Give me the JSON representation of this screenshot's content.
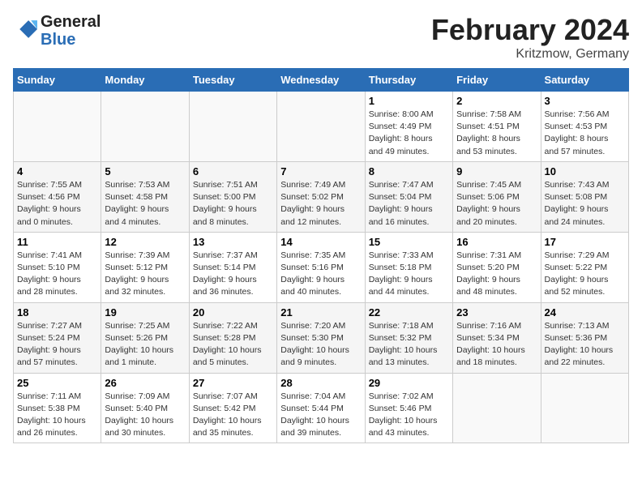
{
  "logo": {
    "line1": "General",
    "line2": "Blue"
  },
  "title": "February 2024",
  "subtitle": "Kritzmow, Germany",
  "weekdays": [
    "Sunday",
    "Monday",
    "Tuesday",
    "Wednesday",
    "Thursday",
    "Friday",
    "Saturday"
  ],
  "weeks": [
    [
      {
        "day": "",
        "info": ""
      },
      {
        "day": "",
        "info": ""
      },
      {
        "day": "",
        "info": ""
      },
      {
        "day": "",
        "info": ""
      },
      {
        "day": "1",
        "info": "Sunrise: 8:00 AM\nSunset: 4:49 PM\nDaylight: 8 hours\nand 49 minutes."
      },
      {
        "day": "2",
        "info": "Sunrise: 7:58 AM\nSunset: 4:51 PM\nDaylight: 8 hours\nand 53 minutes."
      },
      {
        "day": "3",
        "info": "Sunrise: 7:56 AM\nSunset: 4:53 PM\nDaylight: 8 hours\nand 57 minutes."
      }
    ],
    [
      {
        "day": "4",
        "info": "Sunrise: 7:55 AM\nSunset: 4:56 PM\nDaylight: 9 hours\nand 0 minutes."
      },
      {
        "day": "5",
        "info": "Sunrise: 7:53 AM\nSunset: 4:58 PM\nDaylight: 9 hours\nand 4 minutes."
      },
      {
        "day": "6",
        "info": "Sunrise: 7:51 AM\nSunset: 5:00 PM\nDaylight: 9 hours\nand 8 minutes."
      },
      {
        "day": "7",
        "info": "Sunrise: 7:49 AM\nSunset: 5:02 PM\nDaylight: 9 hours\nand 12 minutes."
      },
      {
        "day": "8",
        "info": "Sunrise: 7:47 AM\nSunset: 5:04 PM\nDaylight: 9 hours\nand 16 minutes."
      },
      {
        "day": "9",
        "info": "Sunrise: 7:45 AM\nSunset: 5:06 PM\nDaylight: 9 hours\nand 20 minutes."
      },
      {
        "day": "10",
        "info": "Sunrise: 7:43 AM\nSunset: 5:08 PM\nDaylight: 9 hours\nand 24 minutes."
      }
    ],
    [
      {
        "day": "11",
        "info": "Sunrise: 7:41 AM\nSunset: 5:10 PM\nDaylight: 9 hours\nand 28 minutes."
      },
      {
        "day": "12",
        "info": "Sunrise: 7:39 AM\nSunset: 5:12 PM\nDaylight: 9 hours\nand 32 minutes."
      },
      {
        "day": "13",
        "info": "Sunrise: 7:37 AM\nSunset: 5:14 PM\nDaylight: 9 hours\nand 36 minutes."
      },
      {
        "day": "14",
        "info": "Sunrise: 7:35 AM\nSunset: 5:16 PM\nDaylight: 9 hours\nand 40 minutes."
      },
      {
        "day": "15",
        "info": "Sunrise: 7:33 AM\nSunset: 5:18 PM\nDaylight: 9 hours\nand 44 minutes."
      },
      {
        "day": "16",
        "info": "Sunrise: 7:31 AM\nSunset: 5:20 PM\nDaylight: 9 hours\nand 48 minutes."
      },
      {
        "day": "17",
        "info": "Sunrise: 7:29 AM\nSunset: 5:22 PM\nDaylight: 9 hours\nand 52 minutes."
      }
    ],
    [
      {
        "day": "18",
        "info": "Sunrise: 7:27 AM\nSunset: 5:24 PM\nDaylight: 9 hours\nand 57 minutes."
      },
      {
        "day": "19",
        "info": "Sunrise: 7:25 AM\nSunset: 5:26 PM\nDaylight: 10 hours\nand 1 minute."
      },
      {
        "day": "20",
        "info": "Sunrise: 7:22 AM\nSunset: 5:28 PM\nDaylight: 10 hours\nand 5 minutes."
      },
      {
        "day": "21",
        "info": "Sunrise: 7:20 AM\nSunset: 5:30 PM\nDaylight: 10 hours\nand 9 minutes."
      },
      {
        "day": "22",
        "info": "Sunrise: 7:18 AM\nSunset: 5:32 PM\nDaylight: 10 hours\nand 13 minutes."
      },
      {
        "day": "23",
        "info": "Sunrise: 7:16 AM\nSunset: 5:34 PM\nDaylight: 10 hours\nand 18 minutes."
      },
      {
        "day": "24",
        "info": "Sunrise: 7:13 AM\nSunset: 5:36 PM\nDaylight: 10 hours\nand 22 minutes."
      }
    ],
    [
      {
        "day": "25",
        "info": "Sunrise: 7:11 AM\nSunset: 5:38 PM\nDaylight: 10 hours\nand 26 minutes."
      },
      {
        "day": "26",
        "info": "Sunrise: 7:09 AM\nSunset: 5:40 PM\nDaylight: 10 hours\nand 30 minutes."
      },
      {
        "day": "27",
        "info": "Sunrise: 7:07 AM\nSunset: 5:42 PM\nDaylight: 10 hours\nand 35 minutes."
      },
      {
        "day": "28",
        "info": "Sunrise: 7:04 AM\nSunset: 5:44 PM\nDaylight: 10 hours\nand 39 minutes."
      },
      {
        "day": "29",
        "info": "Sunrise: 7:02 AM\nSunset: 5:46 PM\nDaylight: 10 hours\nand 43 minutes."
      },
      {
        "day": "",
        "info": ""
      },
      {
        "day": "",
        "info": ""
      }
    ]
  ]
}
